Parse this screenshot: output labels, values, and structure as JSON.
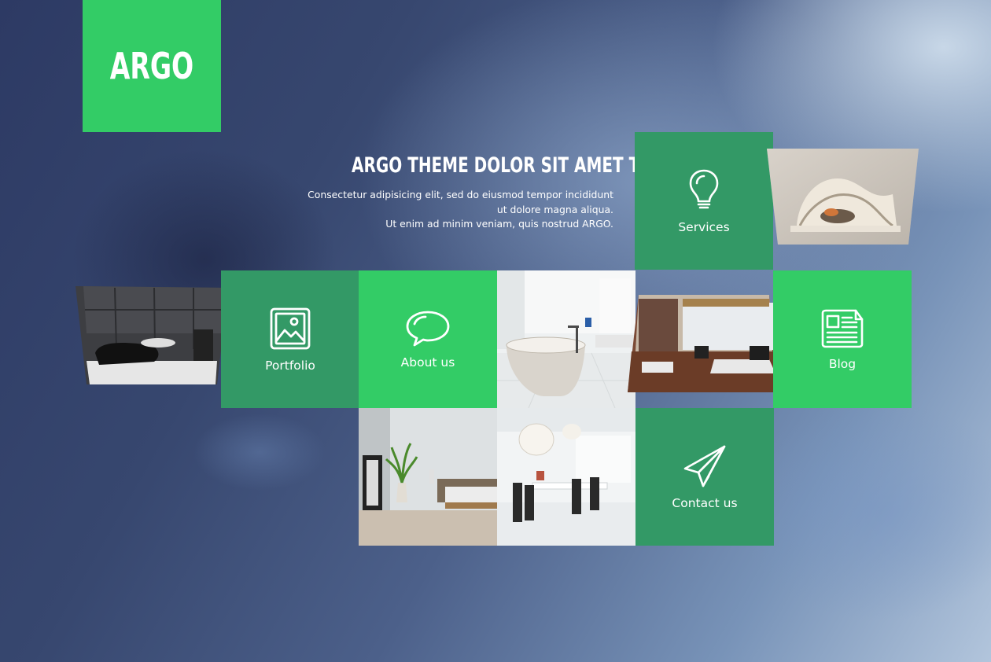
{
  "brand": {
    "logo_text": "ARGO",
    "accent_color": "#33cc66",
    "dark_tile_color": "#339966"
  },
  "hero": {
    "headline": "ARGO THEME DOLOR SIT AMET TELASDE",
    "lines": [
      "Consectetur adipisicing elit, sed do eiusmod tempor incididunt",
      "ut dolore magna aliqua.",
      "Ut enim ad minim veniam, quis nostrud ARGO."
    ]
  },
  "tiles": {
    "services": {
      "label": "Services",
      "icon": "lightbulb-icon"
    },
    "portfolio": {
      "label": "Portfolio",
      "icon": "image-icon"
    },
    "about": {
      "label": "About us",
      "icon": "speech-bubble-icon"
    },
    "blog": {
      "label": "Blog",
      "icon": "newspaper-icon"
    },
    "contact": {
      "label": "Contact us",
      "icon": "paper-plane-icon"
    }
  }
}
